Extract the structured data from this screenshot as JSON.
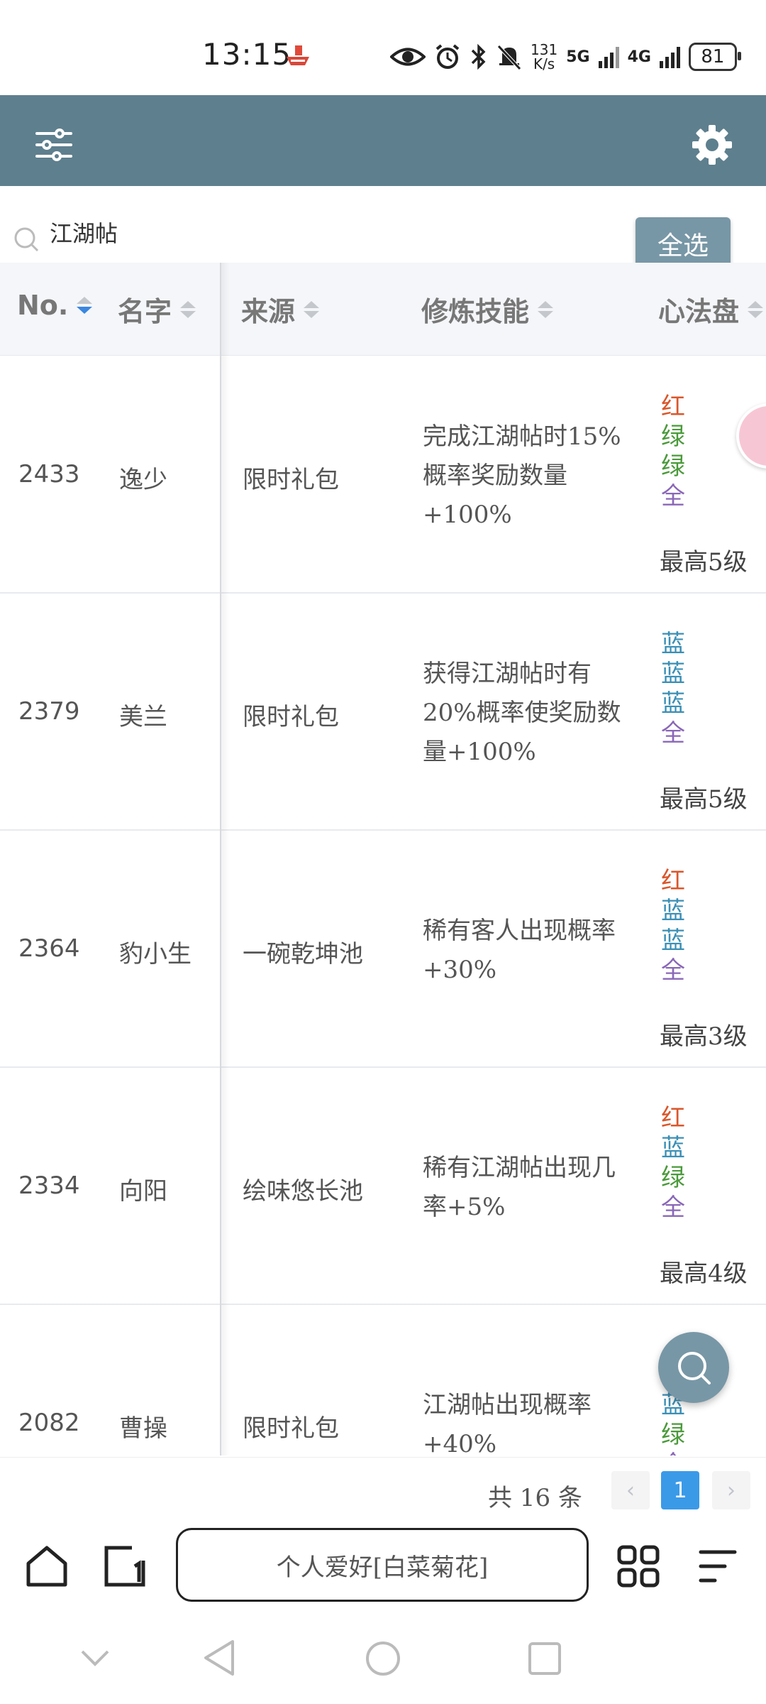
{
  "status": {
    "time": "13:15",
    "speed_top": "131",
    "speed_bottom": "K/s",
    "net1": "5G",
    "net2": "4G",
    "battery": "81"
  },
  "search": {
    "query": "江湖帖"
  },
  "toolbar": {
    "select_all": "全选"
  },
  "table": {
    "headers": {
      "no": "No.",
      "name": "名字",
      "source": "来源",
      "skill": "修炼技能",
      "disk": "心法盘"
    },
    "rows": [
      {
        "no": "2433",
        "name": "逸少",
        "source": "限时礼包",
        "skill": "完成江湖帖时15%概率奖励数量+100%",
        "disk": [
          "红",
          "绿",
          "绿",
          "全"
        ],
        "level": "最高5级"
      },
      {
        "no": "2379",
        "name": "美兰",
        "source": "限时礼包",
        "skill": "获得江湖帖时有20%概率使奖励数量+100%",
        "disk": [
          "蓝",
          "蓝",
          "蓝",
          "全"
        ],
        "level": "最高5级"
      },
      {
        "no": "2364",
        "name": "豹小生",
        "source": "一碗乾坤池",
        "skill": "稀有客人出现概率+30%",
        "disk": [
          "红",
          "蓝",
          "蓝",
          "全"
        ],
        "level": "最高3级"
      },
      {
        "no": "2334",
        "name": "向阳",
        "source": "绘味悠长池",
        "skill": "稀有江湖帖出现几率+5%",
        "disk": [
          "红",
          "蓝",
          "绿",
          "全"
        ],
        "level": "最高4级"
      },
      {
        "no": "2082",
        "name": "曹操",
        "source": "限时礼包",
        "skill": "江湖帖出现概率+40%",
        "disk": [
          "蓝",
          "绿",
          "全"
        ],
        "level": ""
      }
    ]
  },
  "colors": {
    "红": "#d9572b",
    "绿": "#4a9a3a",
    "蓝": "#3b8fb5",
    "全": "#8a67b8",
    "header": "#5e7f8e",
    "accent": "#3a9ae8"
  },
  "pagination": {
    "total": "共 16 条",
    "current": "1",
    "prev": "‹",
    "next": "›"
  },
  "browser": {
    "url_text": "个人爱好[白菜菊花]"
  }
}
